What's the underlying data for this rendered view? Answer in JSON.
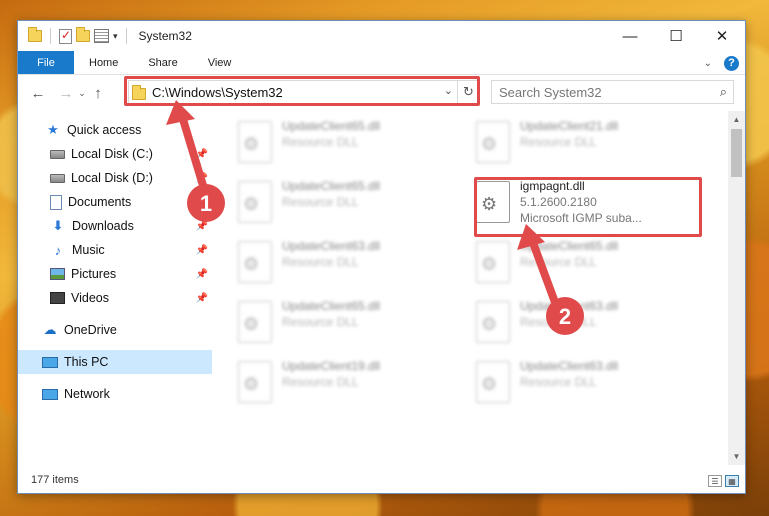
{
  "window": {
    "title": "System32",
    "controls": {
      "minimize": "—",
      "maximize": "☐",
      "close": "✕"
    }
  },
  "ribbon": {
    "tabs": [
      "File",
      "Home",
      "Share",
      "View"
    ]
  },
  "address_bar": {
    "path": "C:\\Windows\\System32",
    "search_placeholder": "Search System32"
  },
  "navigation": {
    "items": [
      {
        "label": "Quick access",
        "icon": "star-icon"
      },
      {
        "label": "Local Disk (C:)",
        "icon": "disk-icon",
        "pinned": true
      },
      {
        "label": "Local Disk (D:)",
        "icon": "disk-icon",
        "pinned": true
      },
      {
        "label": "Documents",
        "icon": "documents-icon",
        "pinned": true
      },
      {
        "label": "Downloads",
        "icon": "downloads-icon",
        "pinned": true
      },
      {
        "label": "Music",
        "icon": "music-icon",
        "pinned": true
      },
      {
        "label": "Pictures",
        "icon": "pictures-icon",
        "pinned": true
      },
      {
        "label": "Videos",
        "icon": "videos-icon",
        "pinned": true
      },
      {
        "label": "OneDrive",
        "icon": "cloud-icon"
      },
      {
        "label": "This PC",
        "icon": "pc-icon",
        "selected": true
      },
      {
        "label": "Network",
        "icon": "network-icon"
      }
    ]
  },
  "files": {
    "left_column": [
      {
        "name": "UpdateClient65.dll",
        "type": "Resource DLL"
      },
      {
        "name": "UpdateClient65.dll",
        "type": "Resource DLL"
      },
      {
        "name": "UpdateClient63.dll",
        "type": "Resource DLL"
      },
      {
        "name": "UpdateClient65.dll",
        "type": "Resource DLL"
      },
      {
        "name": "UpdateClient19.dll",
        "type": "Resource DLL"
      }
    ],
    "right_column": [
      {
        "name": "UpdateClient21.dll",
        "type": "Resource DLL"
      },
      {
        "name": "igmpagnt.dll",
        "version": "5.1.2600.2180",
        "description": "Microsoft IGMP suba...",
        "highlighted": true
      },
      {
        "name": "UpdateClient65.dll",
        "type": "Resource DLL"
      },
      {
        "name": "UpdateClient63.dll",
        "type": "Resource DLL"
      },
      {
        "name": "UpdateClient63.dll",
        "type": "Resource DLL"
      }
    ]
  },
  "status": {
    "item_count": "177 items"
  },
  "annotations": {
    "badge_1": "1",
    "badge_2": "2",
    "color": "#e04a4a"
  }
}
